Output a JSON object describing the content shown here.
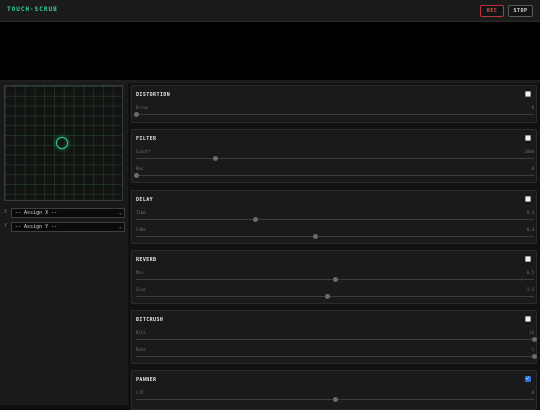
{
  "app": {
    "title": "TOUCH·SCRUB",
    "rec_label": "REC",
    "stop_label": "STOP"
  },
  "pad": {
    "cursor_fraction_x": 0.49,
    "cursor_fraction_y": 0.5,
    "x_tag": "X",
    "y_tag": "Y",
    "x_select": "-- Assign X --",
    "y_select": "-- Assign Y --"
  },
  "effects": [
    {
      "name": "DISTORTION",
      "enabled": false,
      "params": [
        {
          "name": "Drive",
          "value": "0",
          "fraction": 0.0
        }
      ]
    },
    {
      "name": "FILTER",
      "enabled": false,
      "params": [
        {
          "name": "Cutoff",
          "value": "1000",
          "fraction": 0.2
        },
        {
          "name": "Res",
          "value": "0",
          "fraction": 0.0
        }
      ]
    },
    {
      "name": "DELAY",
      "enabled": false,
      "params": [
        {
          "name": "Time",
          "value": "0.3",
          "fraction": 0.3
        },
        {
          "name": "Fdbk",
          "value": "0.4",
          "fraction": 0.45
        }
      ]
    },
    {
      "name": "REVERB",
      "enabled": false,
      "params": [
        {
          "name": "Mix",
          "value": "0.5",
          "fraction": 0.5
        },
        {
          "name": "Size",
          "value": "1.5",
          "fraction": 0.48
        }
      ]
    },
    {
      "name": "BITCRUSH",
      "enabled": false,
      "params": [
        {
          "name": "Bits",
          "value": "16",
          "fraction": 1.0
        },
        {
          "name": "Rate",
          "value": "1",
          "fraction": 1.0
        }
      ]
    },
    {
      "name": "PANNER",
      "enabled": true,
      "params": [
        {
          "name": "L/R",
          "value": "0",
          "fraction": 0.5
        }
      ]
    }
  ]
}
